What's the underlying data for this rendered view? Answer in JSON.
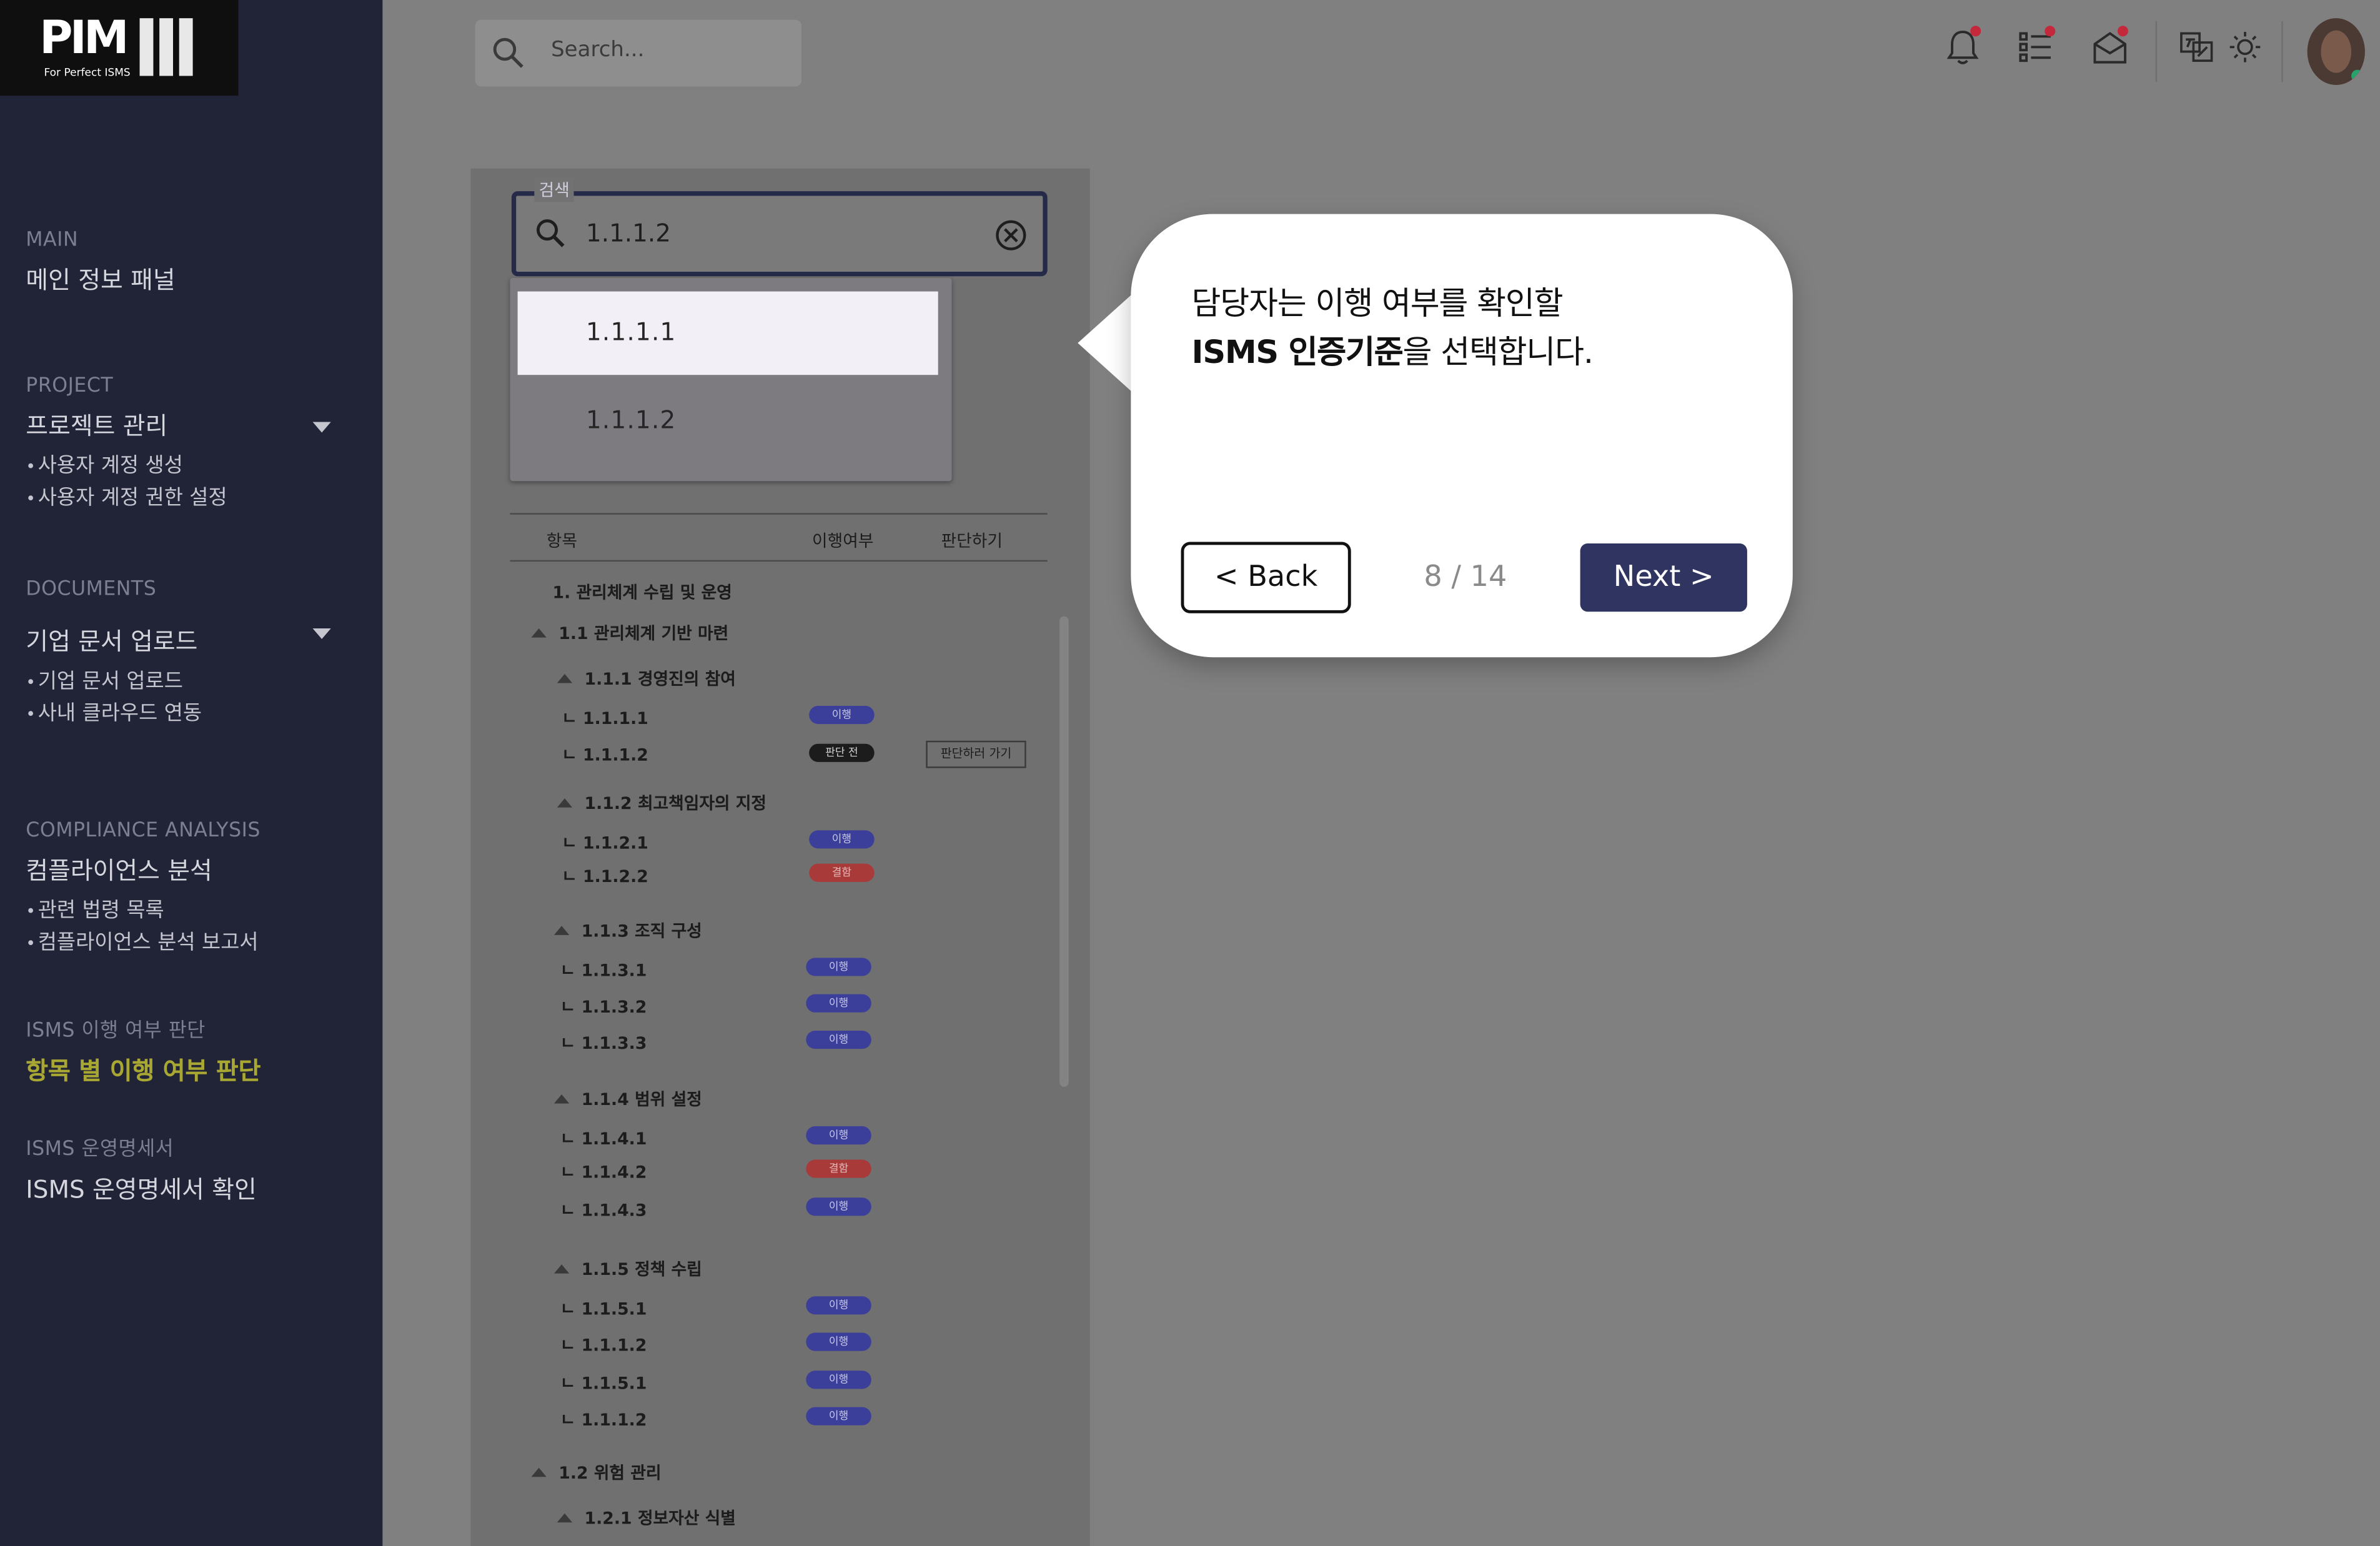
{
  "logo": {
    "text": "PIM",
    "subtitle": "For Perfect ISMS"
  },
  "topbar": {
    "search_placeholder": "Search..."
  },
  "sidebar": {
    "main": {
      "caption": "MAIN",
      "title": "메인 정보 패널"
    },
    "project": {
      "caption": "PROJECT",
      "title": "프로젝트 관리",
      "items": [
        "사용자 계정 생성",
        "사용자 계정 권한 설정"
      ]
    },
    "documents": {
      "caption": "DOCUMENTS",
      "title": "기업 문서 업로드",
      "items": [
        "기업 문서 업로드",
        "사내 클라우드 연동"
      ]
    },
    "compliance": {
      "caption": "COMPLIANCE ANALYSIS",
      "title": "컴플라이언스 분석",
      "items": [
        "관련 법령 목록",
        "컴플라이언스 분석 보고서"
      ]
    },
    "isms_judge": {
      "caption": "ISMS 이행 여부 판단",
      "title": "항목 별 이행 여부 판단"
    },
    "isms_doc": {
      "caption": "ISMS 운영명세서",
      "title": "ISMS 운영명세서 확인"
    }
  },
  "filter": {
    "legend": "검색",
    "value": "1.1.1.2",
    "suggestions": [
      "1.1.1.1",
      "1.1.1.2"
    ]
  },
  "table": {
    "headers": [
      "항목",
      "이행여부",
      "판단하기"
    ],
    "judge_button": "판단하러 가기",
    "rows": {
      "r1": "1. 관리체계 수립 및 운영",
      "r11": "1.1 관리체계 기반 마련",
      "r111": "1.1.1 경영진의 참여",
      "r1111": "1.1.1.1",
      "r1111s": "이행",
      "r1112": "1.1.1.2",
      "r1112s": "판단 전",
      "r112": "1.1.2 최고책임자의 지정",
      "r1121": "1.1.2.1",
      "r1121s": "이행",
      "r1122": "1.1.2.2",
      "r1122s": "결함",
      "r113": "1.1.3 조직 구성",
      "r1131": "1.1.3.1",
      "r1131s": "이행",
      "r1132": "1.1.3.2",
      "r1132s": "이행",
      "r1133": "1.1.3.3",
      "r1133s": "이행",
      "r114": "1.1.4 범위 설정",
      "r1141": "1.1.4.1",
      "r1141s": "이행",
      "r1142": "1.1.4.2",
      "r1142s": "결함",
      "r1143": "1.1.4.3",
      "r1143s": "이행",
      "r115": "1.1.5 정책 수립",
      "r1151": "1.1.5.1",
      "r1151s": "이행",
      "r1152": "1.1.1.2",
      "r1152s": "이행",
      "r1153": "1.1.5.1",
      "r1153s": "이행",
      "r1154": "1.1.1.2",
      "r1154s": "이행",
      "r12": "1.2 위험 관리",
      "r121": "1.2.1 정보자산 식별"
    }
  },
  "tour": {
    "line1": "담당자는 이행 여부를 확인할",
    "line2_bold": "ISMS 인증기준",
    "line2_rest": "을 선택합니다.",
    "back": "< Back",
    "pager": "8 / 14",
    "next": "Next >"
  }
}
